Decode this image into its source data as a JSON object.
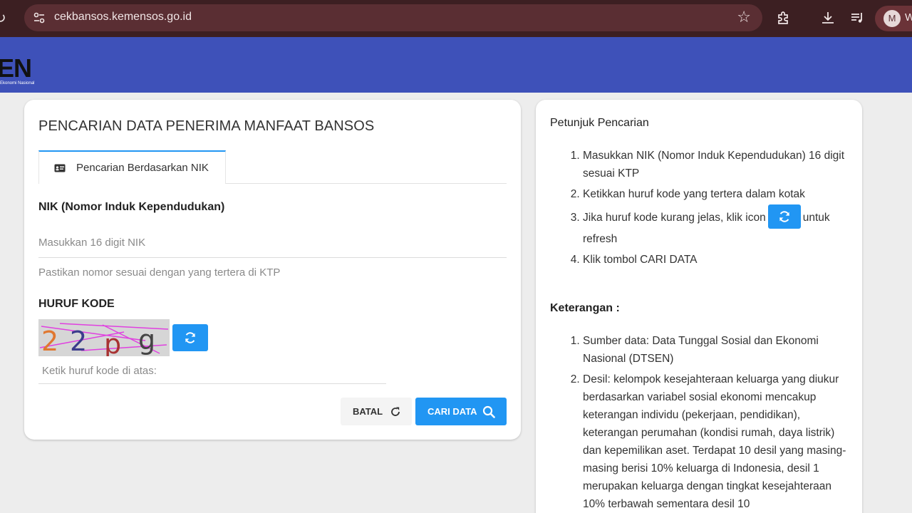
{
  "browser": {
    "url": "cekbansos.kemensos.go.id",
    "profile_initial": "M",
    "profile_more": "W"
  },
  "header": {
    "logo_text": "EN",
    "logo_subtext": "Ekonomi Nasional"
  },
  "search_card": {
    "title": "PENCARIAN DATA PENERIMA MANFAAT BANSOS",
    "tab_label": "Pencarian Berdasarkan NIK",
    "nik_label": "NIK (Nomor Induk Kependudukan)",
    "nik_placeholder": "Masukkan 16 digit NIK",
    "nik_hint": "Pastikan nomor sesuai dengan yang tertera di KTP",
    "kode_label": "HURUF KODE",
    "captcha_text": [
      "2",
      "2",
      "p",
      "g"
    ],
    "kode_placeholder": "Ketik huruf kode di atas:",
    "batal_label": "BATAL",
    "cari_label": "CARI DATA"
  },
  "instructions": {
    "title": "Petunjuk Pencarian",
    "steps": [
      "Masukkan NIK (Nomor Induk Kependudukan) 16 digit sesuai KTP",
      "Ketikkan huruf kode yang tertera dalam kotak",
      "Klik tombol CARI DATA"
    ],
    "step3_before": "Jika huruf kode kurang jelas, klik icon",
    "step3_after": "untuk refresh",
    "notes_title": "Keterangan :",
    "notes": [
      "Sumber data: Data Tunggal Sosial dan Ekonomi Nasional (DTSEN)",
      "Desil: kelompok kesejahteraan keluarga yang diukur berdasarkan variabel sosial ekonomi mencakup keterangan individu (pekerjaan, pendidikan), keterangan perumahan (kondisi rumah, daya listrik) dan kepemilikan aset. Terdapat 10 desil yang masing-masing berisi 10% keluarga di Indonesia, desil 1 merupakan keluarga dengan tingkat kesejahteraan 10% terbawah sementara desil 10"
    ]
  },
  "colors": {
    "primary_blue": "#2196f3",
    "header_blue": "#3e51b9",
    "browser_chrome": "#3c1f22"
  }
}
